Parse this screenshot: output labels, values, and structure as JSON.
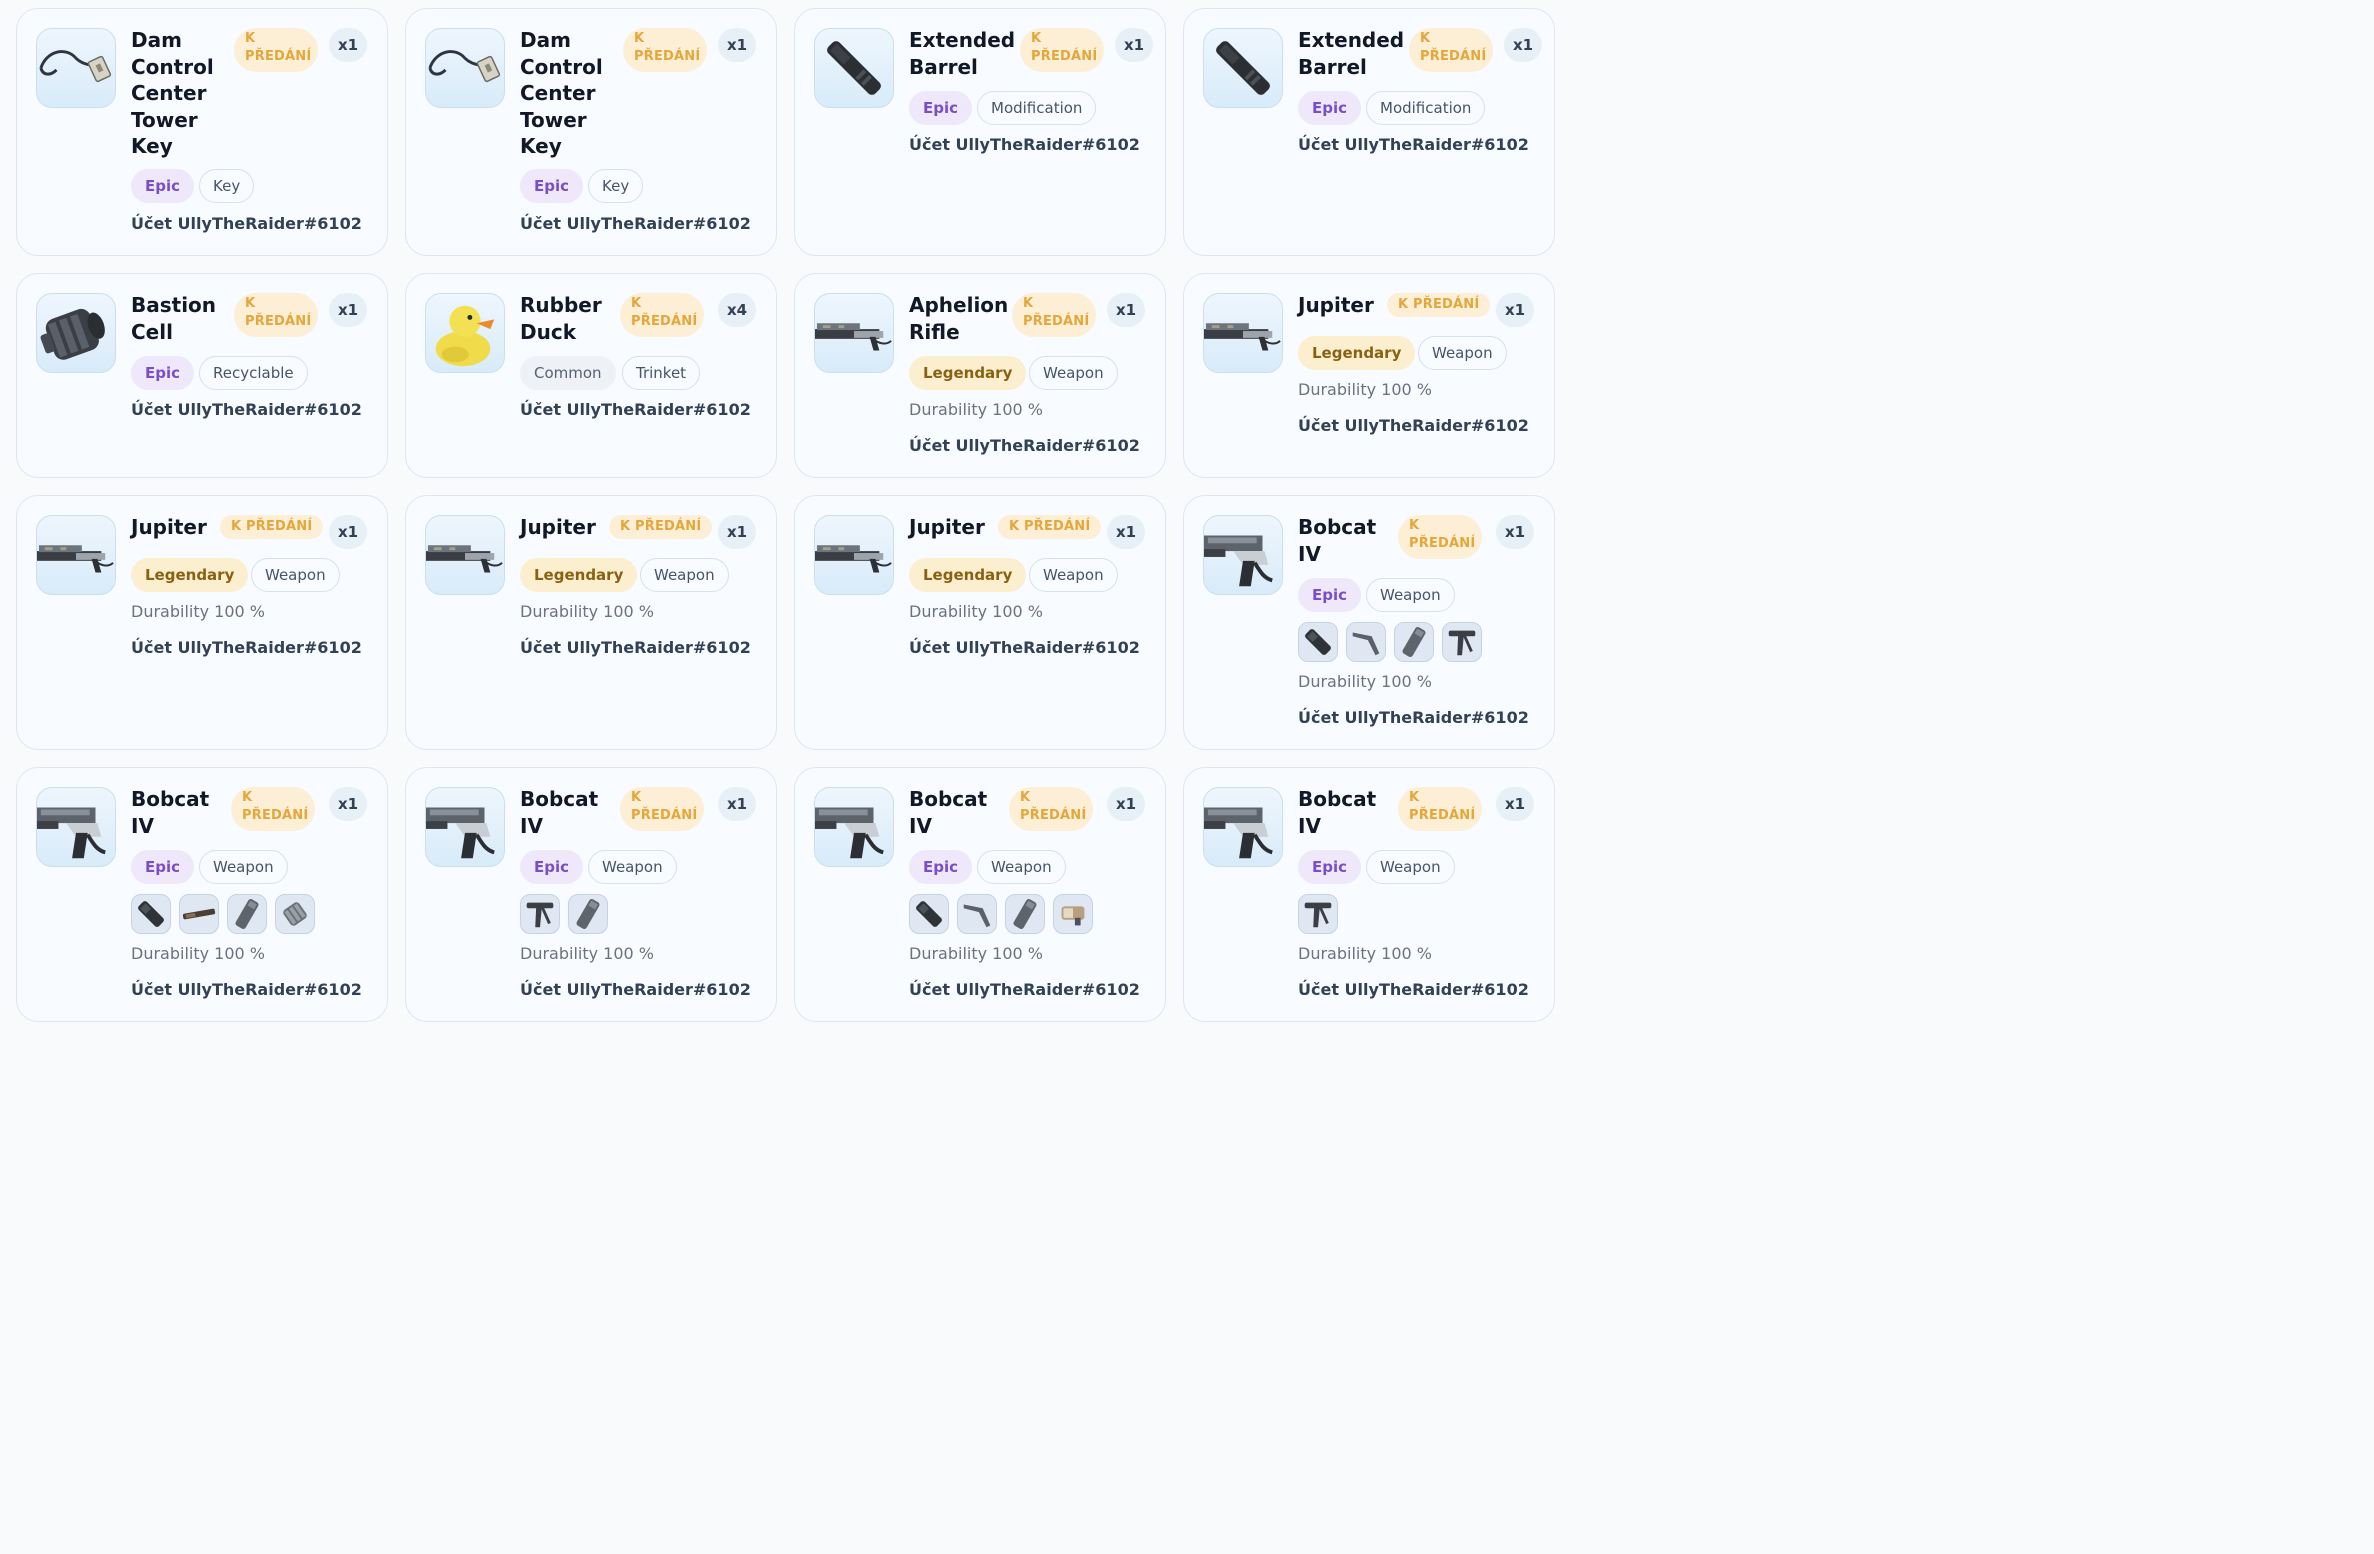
{
  "transfer_badge": "K PŘEDÁNÍ",
  "transfer_badge_lines": [
    "K",
    "PŘEDÁNÍ"
  ],
  "durability_label": "Durability 100 %",
  "account_label": "Účet UllyTheRaider#6102",
  "cards": [
    {
      "name": "Dam Control Center Tower Key",
      "qty": "x1",
      "rarity": "Epic",
      "type": "Key",
      "icon": "key-icon"
    },
    {
      "name": "Dam Control Center Tower Key",
      "qty": "x1",
      "rarity": "Epic",
      "type": "Key",
      "icon": "key-icon"
    },
    {
      "name": "Extended Barrel",
      "qty": "x1",
      "rarity": "Epic",
      "type": "Modification",
      "icon": "barrel-icon"
    },
    {
      "name": "Extended Barrel",
      "qty": "x1",
      "rarity": "Epic",
      "type": "Modification",
      "icon": "barrel-icon"
    },
    {
      "name": "Bastion Cell",
      "qty": "x1",
      "rarity": "Epic",
      "type": "Recyclable",
      "icon": "cell-icon"
    },
    {
      "name": "Rubber Duck",
      "qty": "x4",
      "rarity": "Common",
      "type": "Trinket",
      "icon": "duck-icon"
    },
    {
      "name": "Aphelion Rifle",
      "qty": "x1",
      "rarity": "Legendary",
      "type": "Weapon",
      "icon": "rifle-icon",
      "durability": "Durability 100 %"
    },
    {
      "name": "Jupiter",
      "qty": "x1",
      "rarity": "Legendary",
      "type": "Weapon",
      "icon": "rifle-icon",
      "durability": "Durability 100 %"
    },
    {
      "name": "Jupiter",
      "qty": "x1",
      "rarity": "Legendary",
      "type": "Weapon",
      "icon": "rifle-icon",
      "durability": "Durability 100 %"
    },
    {
      "name": "Jupiter",
      "qty": "x1",
      "rarity": "Legendary",
      "type": "Weapon",
      "icon": "rifle-icon",
      "durability": "Durability 100 %"
    },
    {
      "name": "Jupiter",
      "qty": "x1",
      "rarity": "Legendary",
      "type": "Weapon",
      "icon": "rifle-icon",
      "durability": "Durability 100 %"
    },
    {
      "name": "Bobcat IV",
      "qty": "x1",
      "rarity": "Epic",
      "type": "Weapon",
      "icon": "smg-icon",
      "durability": "Durability 100 %",
      "mods": [
        "suppressor-mod-icon",
        "stock-mod-icon",
        "magazine-mod-icon",
        "grip-mod-icon"
      ]
    },
    {
      "name": "Bobcat IV",
      "qty": "x1",
      "rarity": "Epic",
      "type": "Weapon",
      "icon": "smg-icon",
      "durability": "Durability 100 %",
      "mods": [
        "suppressor-mod-icon",
        "barrel-mod-icon",
        "magazine-mod-icon",
        "extended-mag-mod-icon"
      ]
    },
    {
      "name": "Bobcat IV",
      "qty": "x1",
      "rarity": "Epic",
      "type": "Weapon",
      "icon": "smg-icon",
      "durability": "Durability 100 %",
      "mods": [
        "grip-mod-icon",
        "magazine-mod-icon"
      ]
    },
    {
      "name": "Bobcat IV",
      "qty": "x1",
      "rarity": "Epic",
      "type": "Weapon",
      "icon": "smg-icon",
      "durability": "Durability 100 %",
      "mods": [
        "suppressor-mod-icon",
        "stock-mod-icon",
        "magazine-mod-icon",
        "sight-mod-icon"
      ]
    },
    {
      "name": "Bobcat IV",
      "qty": "x1",
      "rarity": "Epic",
      "type": "Weapon",
      "icon": "smg-icon",
      "durability": "Durability 100 %",
      "mods": [
        "grip-mod-icon"
      ]
    }
  ],
  "colors": {
    "epic": "#7a4fc4",
    "legendary": "#8a6113",
    "transfer": "#e3a73c"
  }
}
